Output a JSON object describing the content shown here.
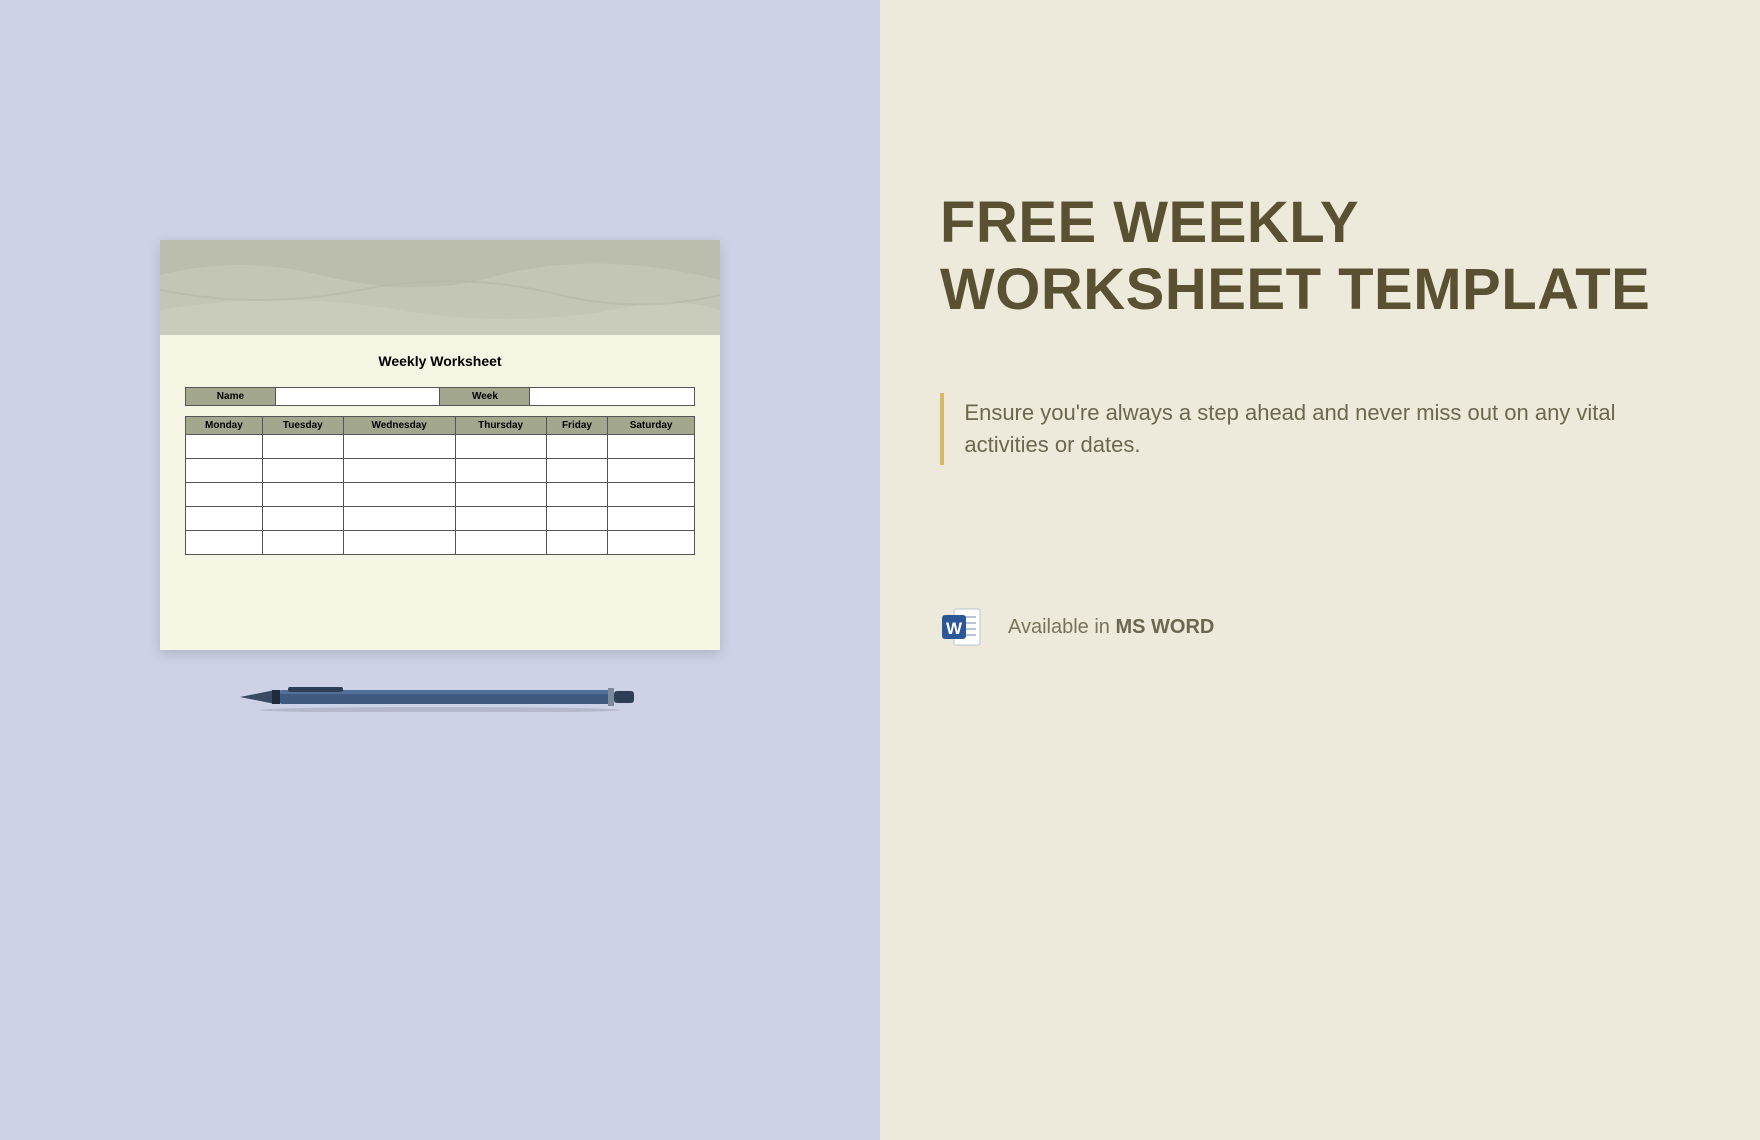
{
  "left": {
    "worksheet": {
      "title": "Weekly Worksheet",
      "info": {
        "name_label": "Name",
        "name_value": "",
        "week_label": "Week",
        "week_value": ""
      },
      "days": [
        "Monday",
        "Tuesday",
        "Wednesday",
        "Thursday",
        "Friday",
        "Saturday"
      ],
      "rows": 5
    }
  },
  "right": {
    "title": "FREE WEEKLY WORKSHEET TEMPLATE",
    "tagline": "Ensure you're always a step ahead and never miss out on any vital activities or dates.",
    "availability_prefix": "Available in ",
    "availability_format": "MS WORD"
  }
}
